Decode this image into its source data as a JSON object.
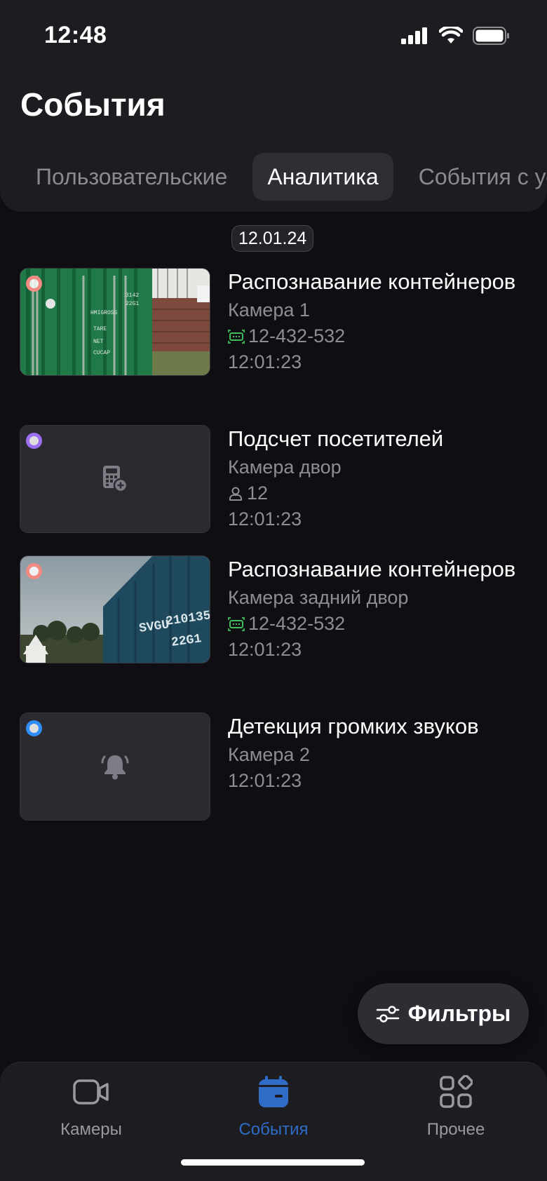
{
  "status_bar": {
    "time": "12:48"
  },
  "header": {
    "title": "События",
    "tabs": [
      {
        "label": "Пользовательские",
        "active": false
      },
      {
        "label": "Аналитика",
        "active": true
      },
      {
        "label": "События с устройств",
        "active": false
      }
    ]
  },
  "date_chip": "12.01.24",
  "events": [
    {
      "title": "Распознавание контейнеров",
      "camera": "Камера 1",
      "meta_icon": "license-plate-icon",
      "meta": "12-432-532",
      "time": "12:01:23",
      "dot_color": "#f28b82",
      "thumb": "container-green-photo"
    },
    {
      "title": "Подсчет посетителей",
      "camera": "Камера двор",
      "meta_icon": "person-icon",
      "meta": "12",
      "time": "12:01:23",
      "dot_color": "#9c6ff0",
      "thumb": "calculator-icon"
    },
    {
      "title": "Распознавание контейнеров",
      "camera": "Камера задний двор",
      "meta_icon": "license-plate-icon",
      "meta": "12-432-532",
      "time": "12:01:23",
      "dot_color": "#f28b82",
      "thumb": "container-blue-photo"
    },
    {
      "title": "Детекция громких звуков",
      "camera": "Камера 2",
      "time": "12:01:23",
      "dot_color": "#2f8ef5",
      "thumb": "bell-icon"
    }
  ],
  "filters_button": {
    "label": "Фильтры"
  },
  "bottom_nav": [
    {
      "label": "Камеры",
      "icon": "video-camera-icon",
      "active": false
    },
    {
      "label": "События",
      "icon": "calendar-icon",
      "active": true
    },
    {
      "label": "Прочее",
      "icon": "apps-grid-icon",
      "active": false
    }
  ],
  "colors": {
    "accent": "#2e6cc6",
    "plate_icon": "#3fbf5a",
    "background": "#0f0e12",
    "surface": "#1d1c21"
  }
}
